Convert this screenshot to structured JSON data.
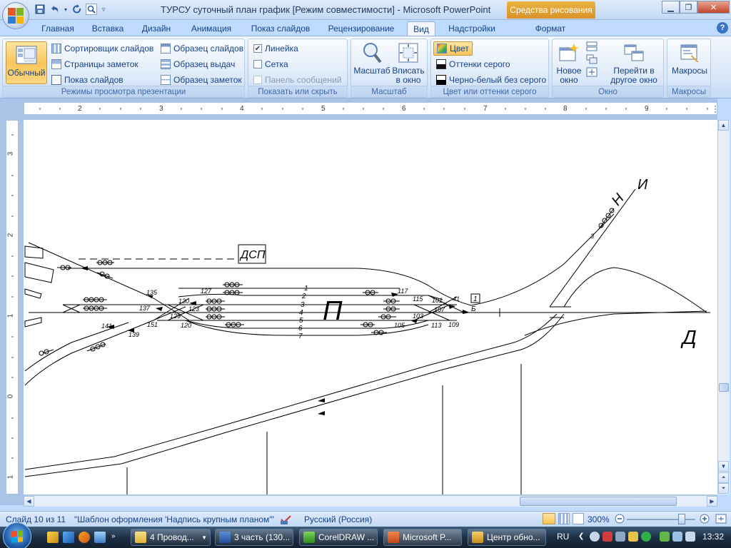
{
  "window": {
    "title": "ТУРСУ суточный план график [Режим совместимости] - Microsoft PowerPoint",
    "context_tab": "Средства рисования"
  },
  "tabs": [
    {
      "label": "Главная"
    },
    {
      "label": "Вставка"
    },
    {
      "label": "Дизайн"
    },
    {
      "label": "Анимация"
    },
    {
      "label": "Показ слайдов"
    },
    {
      "label": "Рецензирование"
    },
    {
      "label": "Вид"
    },
    {
      "label": "Надстройки"
    },
    {
      "label": "Формат"
    }
  ],
  "ribbon": {
    "views": {
      "normal": "Обычный",
      "sorter": "Сортировщик слайдов",
      "notes_page": "Страницы заметок",
      "slideshow": "Показ слайдов",
      "slide_master": "Образец слайдов",
      "handout_master": "Образец выдач",
      "notes_master": "Образец заметок",
      "group": "Режимы просмотра презентации"
    },
    "show_hide": {
      "ruler": "Линейка",
      "grid": "Сетка",
      "message_bar": "Панель сообщений",
      "group": "Показать или скрыть",
      "ruler_checked": true,
      "grid_checked": false
    },
    "zoom": {
      "zoom": "Масштаб",
      "fit_line1": "Вписать",
      "fit_line2": "в окно",
      "group": "Масштаб"
    },
    "color": {
      "color": "Цвет",
      "grayscale": "Оттенки серого",
      "bw": "Черно-белый без серого",
      "group": "Цвет или оттенки серого"
    },
    "window": {
      "new_line1": "Новое",
      "new_line2": "окно",
      "switch_line1": "Перейти в",
      "switch_line2": "другое окно",
      "group": "Окно"
    },
    "macros": {
      "macros": "Макросы",
      "group": "Макросы"
    }
  },
  "ruler": {
    "h_numbers": [
      "2",
      "3",
      "4",
      "5",
      "6",
      "7",
      "8",
      "9"
    ],
    "v_numbers": [
      "3",
      "2",
      "1",
      "0",
      "1"
    ]
  },
  "slide": {
    "labels": {
      "station_big": "П",
      "dsp": "ДСП",
      "dir_n": "Н",
      "dir_i": "И",
      "dir_d": "Д",
      "marker_1": "1",
      "marker_b": "Б",
      "tracks": [
        "1",
        "2",
        "3",
        "4",
        "5",
        "6",
        "7"
      ],
      "switch_numbers": [
        "135",
        "127",
        "137",
        "139",
        "130",
        "123",
        "129",
        "141",
        "151",
        "120",
        "117",
        "115",
        "101",
        "41",
        "107",
        "103",
        "105",
        "113",
        "109",
        "3"
      ]
    }
  },
  "status": {
    "slide": "Слайд 10 из 11",
    "theme": "\"Шаблон оформления 'Надпись крупным планом'\"",
    "language": "Русский (Россия)",
    "zoom": "300%"
  },
  "taskbar": {
    "items": [
      {
        "label": "4 Провод..."
      },
      {
        "label": "3 часть (130..."
      },
      {
        "label": "CorelDRAW ..."
      },
      {
        "label": "Microsoft P..."
      },
      {
        "label": "Центр обно..."
      }
    ],
    "lang": "RU",
    "clock": "13:32"
  }
}
